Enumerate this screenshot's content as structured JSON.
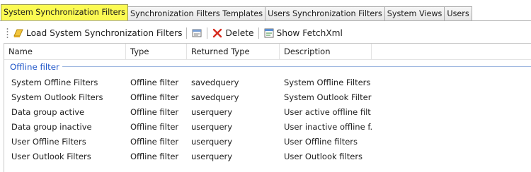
{
  "tabs": [
    {
      "label": "System Synchronization Filters",
      "active": true
    },
    {
      "label": "Synchronization Filters Templates",
      "active": false
    },
    {
      "label": "Users Synchronization Filters",
      "active": false
    },
    {
      "label": "System Views",
      "active": false
    },
    {
      "label": "Users",
      "active": false
    }
  ],
  "toolbar": {
    "load_label": "Load System Synchronization Filters",
    "delete_label": "Delete",
    "fetchxml_label": "Show FetchXml"
  },
  "grid": {
    "columns": [
      "Name",
      "Type",
      "Returned Type",
      "Description"
    ],
    "group_label": "Offline filter",
    "rows": [
      {
        "name": "System Offline Filters",
        "type": "Offline filter",
        "returned_type": "savedquery",
        "description": "System Offline Filters"
      },
      {
        "name": "System Outlook Filters",
        "type": "Offline filter",
        "returned_type": "savedquery",
        "description": "System Outlook Filters"
      },
      {
        "name": "Data group active",
        "type": "Offline filter",
        "returned_type": "userquery",
        "description": "User active offline filt..."
      },
      {
        "name": "Data group inactive",
        "type": "Offline filter",
        "returned_type": "userquery",
        "description": "User inactive offline f..."
      },
      {
        "name": "User Offline Filters",
        "type": "Offline filter",
        "returned_type": "userquery",
        "description": "User Offline filters"
      },
      {
        "name": "User Outlook Filters",
        "type": "Offline filter",
        "returned_type": "userquery",
        "description": "User Outlook filters"
      }
    ]
  },
  "colors": {
    "active_tab": "#fbfa52",
    "group_text": "#1e55c8",
    "delete_icon": "#d62c1f"
  },
  "icons": {
    "load": "filter-load-icon",
    "properties": "properties-icon",
    "delete": "delete-x-icon",
    "fetchxml": "fetchxml-icon"
  }
}
